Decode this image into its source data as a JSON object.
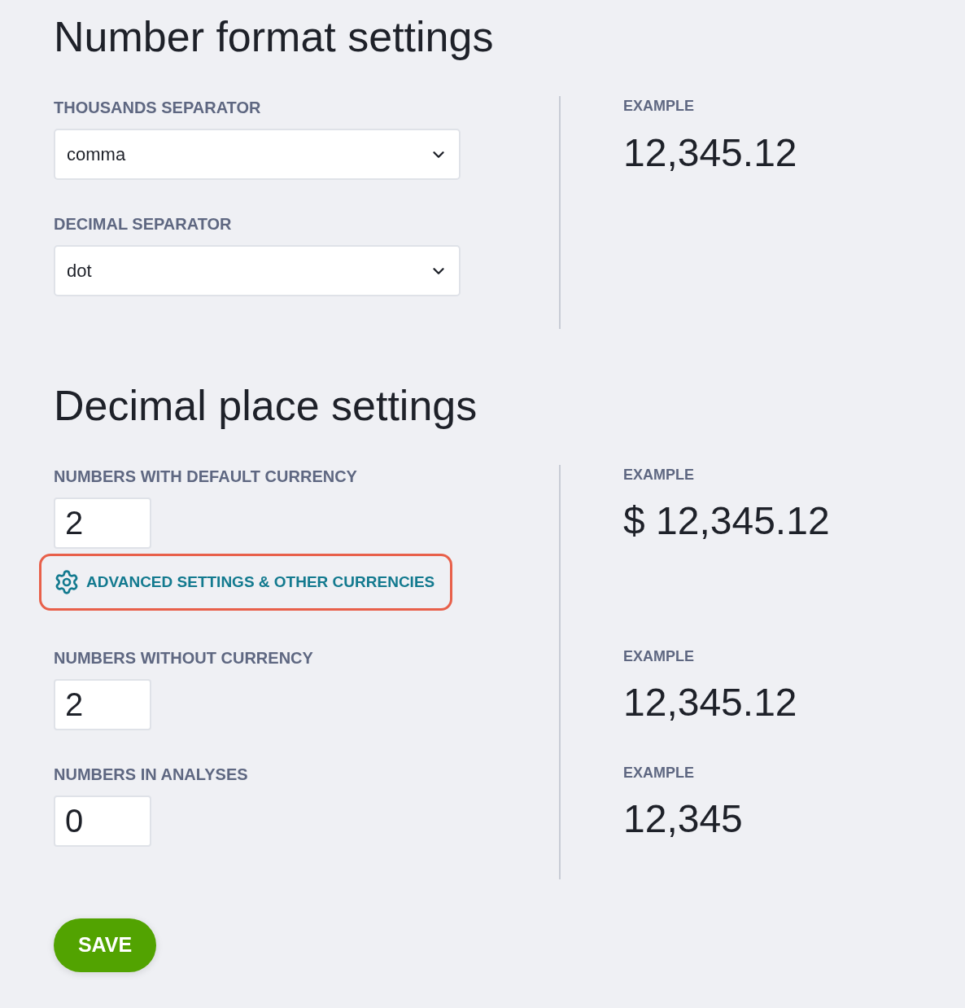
{
  "number_format": {
    "title": "Number format settings",
    "fields": [
      {
        "label": "THOUSANDS SEPARATOR",
        "value": "comma"
      },
      {
        "label": "DECIMAL SEPARATOR",
        "value": "dot"
      }
    ],
    "example": {
      "label": "EXAMPLE",
      "value": "12,345.12"
    }
  },
  "decimal_places": {
    "title": "Decimal place settings",
    "fields": [
      {
        "label": "NUMBERS WITH DEFAULT CURRENCY",
        "value": "2",
        "example_label": "EXAMPLE",
        "example": "$ 12,345.12",
        "link": {
          "text": "ADVANCED SETTINGS & OTHER CURRENCIES",
          "highlighted": true
        }
      },
      {
        "label": "NUMBERS WITHOUT CURRENCY",
        "value": "2",
        "example_label": "EXAMPLE",
        "example": "12,345.12"
      },
      {
        "label": "NUMBERS IN ANALYSES",
        "value": "0",
        "example_label": "EXAMPLE",
        "example": "12,345"
      }
    ]
  },
  "save_button": "SAVE"
}
